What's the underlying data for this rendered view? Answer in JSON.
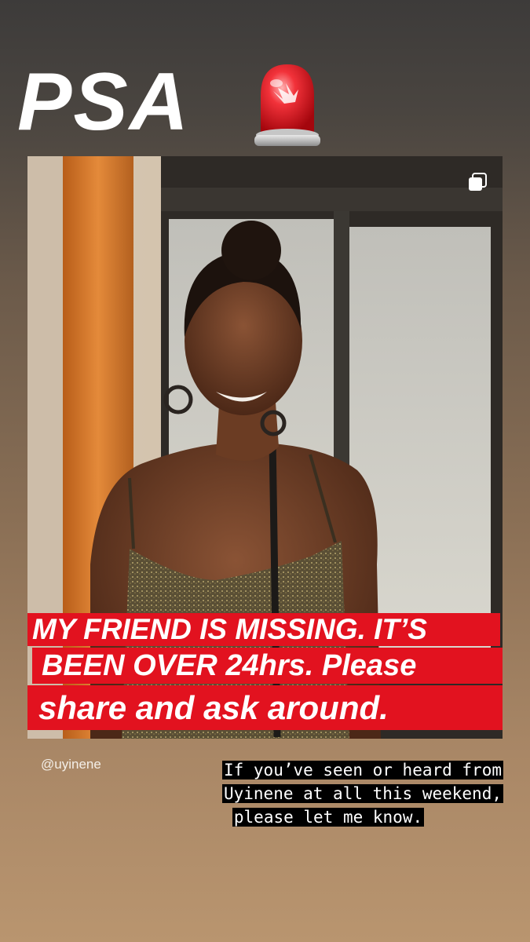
{
  "story": {
    "title": "PSA",
    "icons": {
      "siren": "police-car-light-icon",
      "carousel": "multiple-posts-icon"
    },
    "caption": {
      "line1": "MY FRIEND IS MISSING. IT’S",
      "line2": "BEEN OVER 24hrs. Please",
      "line3": "share and ask around."
    },
    "handle": "@uyinene",
    "note": {
      "line1": "If you’ve seen or heard from",
      "line2": "Uyinene at all this weekend,",
      "line3": "please let me know."
    },
    "colors": {
      "caption_bg": "#e2121f",
      "note_bg": "#000000",
      "text": "#ffffff"
    }
  }
}
